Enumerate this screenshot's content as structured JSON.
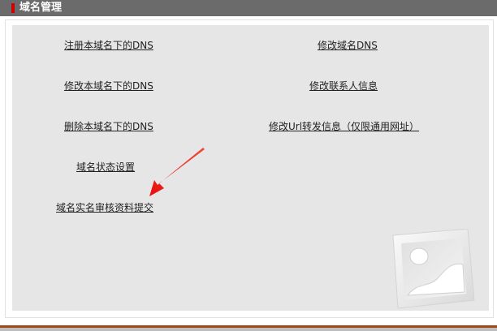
{
  "header": {
    "title": "域名管理"
  },
  "links": {
    "register_dns": "注册本域名下的DNS",
    "modify_domain_dns": "修改域名DNS",
    "modify_dns": "修改本域名下的DNS",
    "modify_contact": "修改联系人信息",
    "delete_dns": "删除本域名下的DNS",
    "modify_url_forward": "修改Url转发信息（仅限通用网址）",
    "domain_status": "域名状态设置",
    "realname_submit": "域名实名审核资料提交"
  },
  "colors": {
    "titlebar": "#6b6b6b",
    "marker": "#d10000",
    "panel": "#e6e6e6",
    "arrow": "#e8100e"
  },
  "icons": {
    "placeholder": "image-placeholder-icon"
  }
}
